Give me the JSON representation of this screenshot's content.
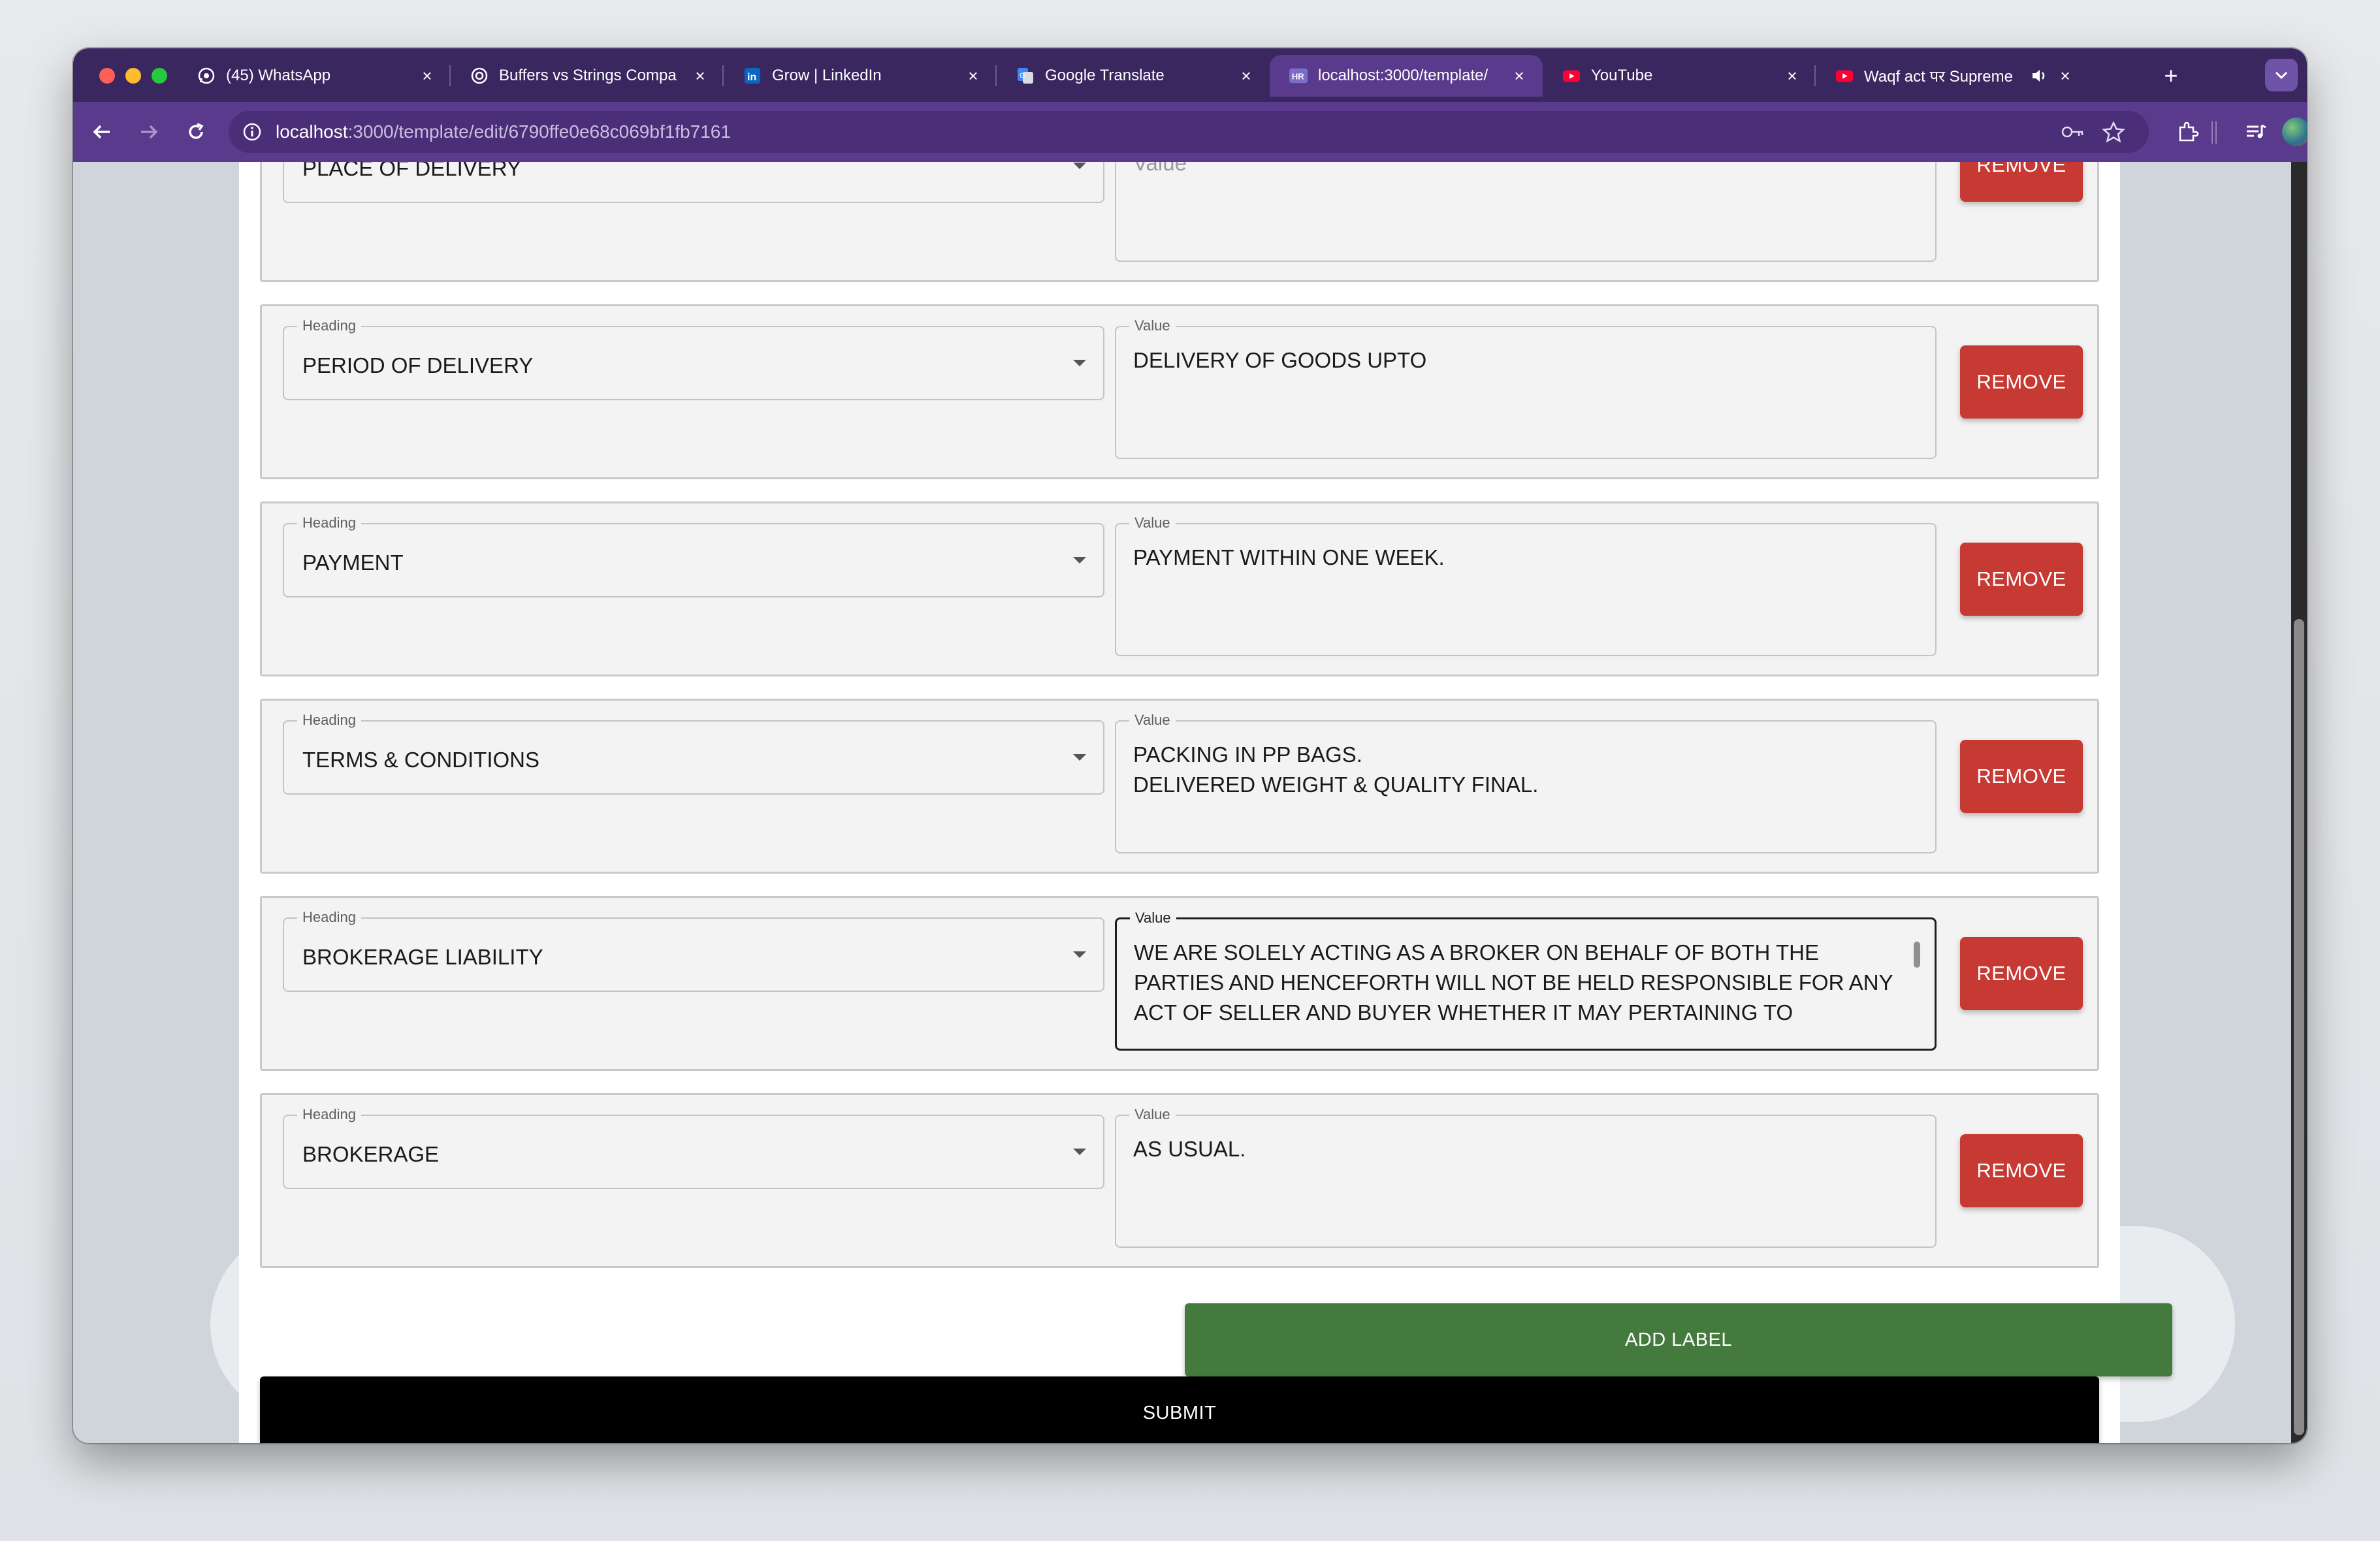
{
  "browser": {
    "tabs": [
      {
        "title": "(45) WhatsApp",
        "icon": "whatsapp-icon"
      },
      {
        "title": "Buffers vs Strings Compa",
        "icon": "chatgpt-icon"
      },
      {
        "title": "Grow | LinkedIn",
        "icon": "linkedin-icon"
      },
      {
        "title": "Google Translate",
        "icon": "google-translate-icon"
      },
      {
        "title": "localhost:3000/template/",
        "icon": "hr-icon",
        "badge": "HR",
        "active": true
      },
      {
        "title": "YouTube",
        "icon": "youtube-icon"
      },
      {
        "title": "Waqf act पर Supreme",
        "icon": "youtube-icon",
        "audio": true
      }
    ],
    "url_host": "localhost",
    "url_path": ":3000/template/edit/6790ffe0e68c069bf1fb7161",
    "colors": {
      "tab_strip": "#3b2760",
      "toolbar": "#5a3a8c"
    }
  },
  "form": {
    "labels": {
      "heading": "Heading",
      "value": "Value"
    },
    "remove_label": "REMOVE",
    "rows": [
      {
        "heading": "PLACE OF DELIVERY",
        "value": "",
        "value_placeholder": "Value"
      },
      {
        "heading": "PERIOD OF DELIVERY",
        "value": "DELIVERY OF GOODS UPTO"
      },
      {
        "heading": "PAYMENT",
        "value": "PAYMENT WITHIN ONE WEEK."
      },
      {
        "heading": "TERMS & CONDITIONS",
        "value": "PACKING IN PP BAGS.\nDELIVERED WEIGHT & QUALITY FINAL."
      },
      {
        "heading": "BROKERAGE LIABILITY",
        "value": "WE ARE SOLELY ACTING AS A BROKER ON BEHALF OF BOTH THE\nPARTIES AND HENCEFORTH WILL NOT BE HELD RESPONSIBLE FOR ANY\nACT OF SELLER AND BUYER WHETHER IT MAY PERTAINING TO",
        "focused": true
      },
      {
        "heading": "BROKERAGE",
        "value": "AS USUAL."
      }
    ],
    "add_label_button": "ADD LABEL",
    "submit_button": "SUBMIT",
    "colors": {
      "remove": "#c73a34",
      "add_label": "#447a3e",
      "submit": "#000000"
    }
  }
}
